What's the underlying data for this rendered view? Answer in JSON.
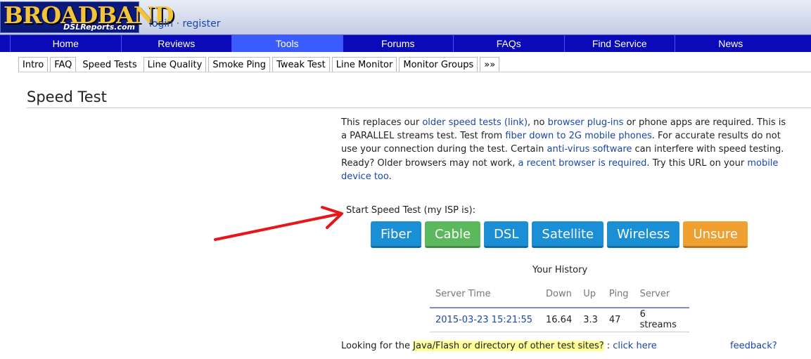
{
  "header": {
    "logo_main": "BROADBAND",
    "logo_sub": "DSLReports.com",
    "login": "login",
    "separator": "·",
    "register": "register"
  },
  "nav": {
    "items": [
      "Home",
      "Reviews",
      "Tools",
      "Forums",
      "FAQs",
      "Find Service",
      "News"
    ],
    "active": "Tools"
  },
  "subtabs": {
    "items": [
      "Intro",
      "FAQ",
      "Speed Tests",
      "Line Quality",
      "Smoke Ping",
      "Tweak Test",
      "Line Monitor",
      "Monitor Groups",
      "»»"
    ],
    "active": "Speed Tests"
  },
  "page_title": "Speed Test",
  "intro": {
    "t1": "This replaces our ",
    "l1": "older speed tests (link)",
    "t2": ", no ",
    "l2": "browser plug-ins",
    "t3": " or phone apps are required. This is a PARALLEL streams test. Test from ",
    "l3": "fiber down to 2G mobile phones",
    "t4": ". For accurate results do not use your connection during the test. Certain ",
    "l4": "anti-virus software",
    "t5": " can interfere with speed testing.",
    "t6": "Ready? Older browsers may not work, ",
    "l5": "a recent browser is required",
    "t7": ". Try this URL on your ",
    "l6": "mobile device too",
    "t8": "."
  },
  "start_label": "Start Speed Test (my ISP is):",
  "buttons": {
    "fiber": "Fiber",
    "cable": "Cable",
    "dsl": "DSL",
    "satellite": "Satellite",
    "wireless": "Wireless",
    "unsure": "Unsure"
  },
  "history": {
    "title": "Your History",
    "headers": [
      "Server Time",
      "Down",
      "Up",
      "Ping",
      "Server"
    ],
    "rows": [
      [
        "2015-03-23 15:21:55",
        "16.64",
        "3.3",
        "47",
        "6 streams"
      ]
    ]
  },
  "footer": {
    "looking": "Looking for the ",
    "highlight": "Java/Flash or directory of other test sites?",
    "colon": " : ",
    "click_here": "click here",
    "feedback": "feedback?"
  },
  "colors": {
    "nav_bg": "#0a0ab8",
    "nav_active": "#3a5cff",
    "btn_blue": "#1a8fd6",
    "btn_green": "#5cb85c",
    "btn_orange": "#f0a030",
    "link": "#1a47a8",
    "annotation_arrow": "#e8151b"
  }
}
